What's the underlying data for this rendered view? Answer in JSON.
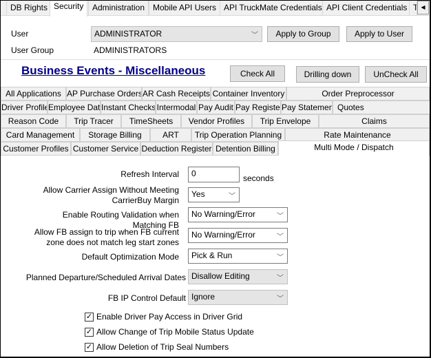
{
  "top_tabs": [
    "DB Rights",
    "Security",
    "Administration",
    "Mobile API Users",
    "API TruckMate Credentials",
    "API Client Credentials",
    "T"
  ],
  "selected_top_tab": "Security",
  "user": {
    "label": "User",
    "value": "ADMINISTRATOR",
    "group_label": "User Group",
    "group_value": "ADMINISTRATORS",
    "apply_group": "Apply to Group",
    "apply_user": "Apply to User"
  },
  "section": {
    "title": "Business Events - Miscellaneous",
    "check_all": "Check All",
    "drilling_down": "Drilling down",
    "uncheck_all": "UnCheck All"
  },
  "tab_rows": [
    [
      "All Applications",
      "AP Purchase Orders",
      "AR Cash Receipts",
      "Container Inventory",
      "Order Preprocessor"
    ],
    [
      "Driver Profile",
      "Employee Data",
      "Instant Checks",
      "Intermodal",
      "Pay Audit",
      "Pay Register",
      "Pay Statement",
      "Quotes"
    ],
    [
      "Reason Code",
      "Trip Tracer",
      "TimeSheets",
      "Vendor Profiles",
      "Trip Envelope",
      "Claims"
    ],
    [
      "Card Management",
      "Storage Billing",
      "ART",
      "Trip Operation Planning",
      "Rate Maintenance"
    ],
    [
      "Customer Profiles",
      "Customer Service",
      "Deduction Register",
      "Detention Billing",
      "Multi Mode / Dispatch"
    ]
  ],
  "selected_tab": "Multi Mode / Dispatch",
  "form": {
    "refresh_label": "Refresh Interval",
    "refresh_value": "0",
    "refresh_unit": "seconds",
    "carrier_label": "Allow Carrier Assign Without Meeting CarrierBuy Margin",
    "carrier_value": "Yes",
    "routing_label": "Enable Routing Validation when Matching FB",
    "routing_value": "No Warning/Error",
    "fbzone_label": "Allow FB assign to trip when FB current zone does not match leg start zones",
    "fbzone_value": "No Warning/Error",
    "optim_label": "Default Optimization Mode",
    "optim_value": "Pick & Run",
    "planned_label": "Planned Departure/Scheduled Arrival Dates",
    "planned_value": "Disallow Editing",
    "ipcontrol_label": "FB IP Control Default",
    "ipcontrol_value": "Ignore",
    "checkboxes": [
      {
        "label": "Enable Driver Pay Access in Driver Grid",
        "checked": true
      },
      {
        "label": "Allow Change of Trip Mobile Status Update",
        "checked": true
      },
      {
        "label": "Allow Deletion of Trip Seal Numbers",
        "checked": true
      }
    ]
  }
}
